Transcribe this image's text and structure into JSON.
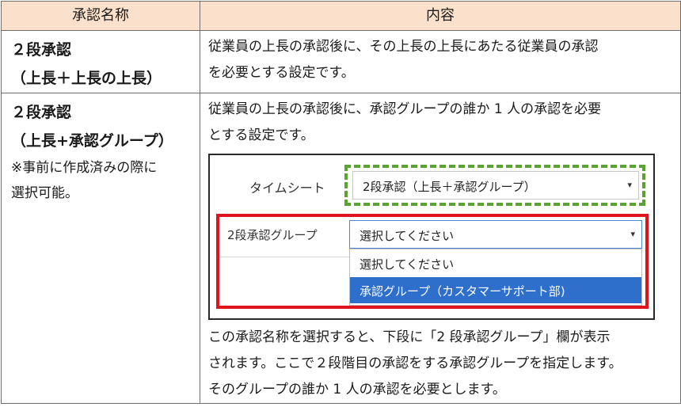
{
  "table": {
    "header": {
      "col1": "承認名称",
      "col2": "内容"
    },
    "row1": {
      "name_line1": "２段承認",
      "name_line2": "（上長＋上長の上長）",
      "desc_line1": "従業員の上長の承認後に、その上長の上長にあたる従業員の承認",
      "desc_line2": "を必要とする設定です。"
    },
    "row2": {
      "name_line1": "２段承認",
      "name_line2": "（上長+承認グループ）",
      "note_line1": "※事前に作成済みの際に",
      "note_line2": "選択可能。",
      "desc_line1": "従業員の上長の承認後に、承認グループの誰か 1 人の承認を必要",
      "desc_line2": "とする設定です。",
      "after_line1": "この承認名称を選択すると、下段に「2 段承認グループ」欄が表示",
      "after_line2": "されます。ここで２段階目の承認をする承認グループを指定します。",
      "after_line3": "そのグループの誰か 1 人の承認を必要とします。"
    }
  },
  "screenshot": {
    "timesheet_label": "タイムシート",
    "timesheet_value": "2段承認（上長＋承認グループ）",
    "group_label": "2段承認グループ",
    "group_value": "選択してください",
    "options": [
      "選択してください",
      "承認グループ（カスタマーサポート部)"
    ],
    "caret_icon": "▾",
    "colors": {
      "green_dashed": "#5aa532",
      "red_frame": "#e0141c",
      "selected_option": "#2e6fcb",
      "header_bg": "#fbe0cb"
    }
  }
}
